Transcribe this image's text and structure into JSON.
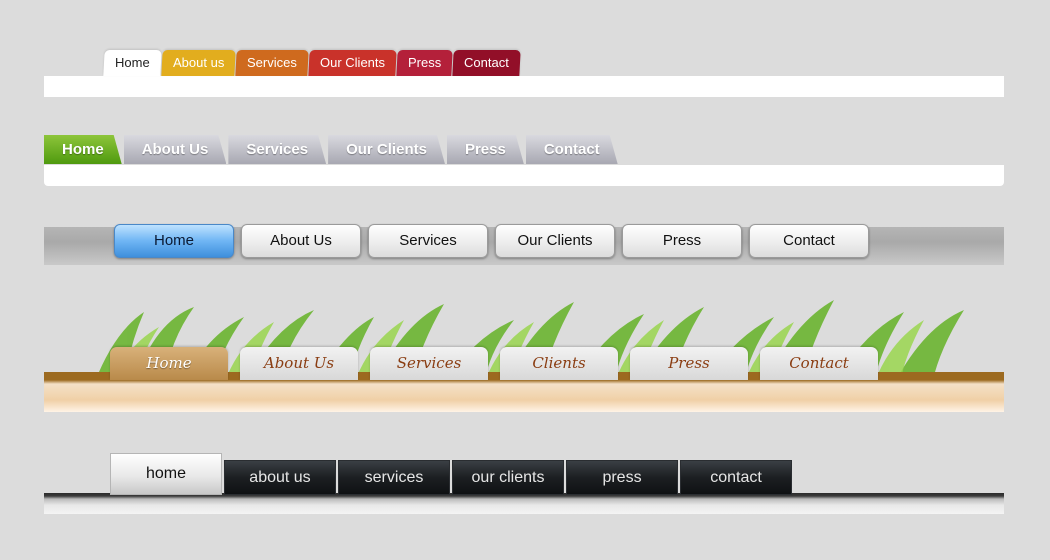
{
  "menus": [
    {
      "style": "colored-tabs",
      "items": [
        "Home",
        "About us",
        "Services",
        "Our Clients",
        "Press",
        "Contact"
      ],
      "active_index": 0,
      "colors": [
        "#ffffff",
        "#e2ad1e",
        "#cf6a1e",
        "#c9322a",
        "#b4203a",
        "#920f28"
      ]
    },
    {
      "style": "silver-slanted-tabs",
      "items": [
        "Home",
        "About Us",
        "Services",
        "Our Clients",
        "Press",
        "Contact"
      ],
      "active_index": 0,
      "colors": {
        "active": "#6fb522",
        "inactive": "#bcbcc4"
      }
    },
    {
      "style": "rounded-buttons",
      "items": [
        "Home",
        "About Us",
        "Services",
        "Our Clients",
        "Press",
        "Contact"
      ],
      "active_index": 0,
      "colors": {
        "active": "#6fb5f4",
        "inactive": "#f2f2f2",
        "bar": "#aaaaaa"
      }
    },
    {
      "style": "grass-script-tabs",
      "items": [
        "Home",
        "About Us",
        "Services",
        "Clients",
        "Press",
        "Contact"
      ],
      "active_index": 0,
      "colors": {
        "active": "#c9a063",
        "text": "#8a3d12",
        "grass": "#5fa82a"
      }
    },
    {
      "style": "dark-glossy-tabs",
      "items": [
        "home",
        "about us",
        "services",
        "our clients",
        "press",
        "contact"
      ],
      "active_index": 0,
      "colors": {
        "active": "#ececec",
        "inactive": "#1c1f22"
      }
    }
  ]
}
